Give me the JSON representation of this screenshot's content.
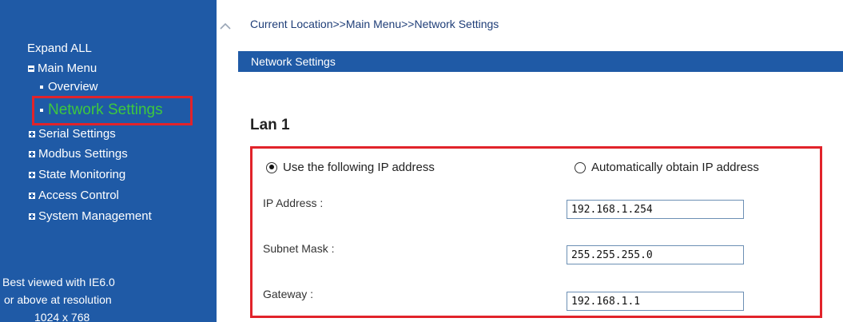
{
  "sidebar": {
    "expand_all": "Expand ALL",
    "main_menu": "Main Menu",
    "items": [
      {
        "label": "Overview"
      },
      {
        "label": "Network Settings"
      },
      {
        "label": "Serial Settings"
      },
      {
        "label": "Modbus Settings"
      },
      {
        "label": "State Monitoring"
      },
      {
        "label": "Access Control"
      },
      {
        "label": "System Management"
      }
    ],
    "footer_line1": "Best viewed with IE6.0",
    "footer_line2": "or above at resolution",
    "footer_line3": "1024 x 768"
  },
  "breadcrumb": "Current Location>>Main Menu>>Network Settings",
  "section_title": "Network Settings",
  "lan_title": "Lan 1",
  "ip_mode": {
    "manual_label": "Use the following IP address",
    "auto_label": "Automatically obtain IP address",
    "selected": "manual"
  },
  "fields": {
    "ip_address": {
      "label": "IP Address :",
      "value": "192.168.1.254"
    },
    "subnet_mask": {
      "label": "Subnet Mask :",
      "value": "255.255.255.0"
    },
    "gateway": {
      "label": "Gateway :",
      "value": "192.168.1.1"
    }
  },
  "colors": {
    "brand_blue": "#1f5aa6",
    "active_green": "#3ec83e",
    "highlight_red": "#e1232a"
  }
}
